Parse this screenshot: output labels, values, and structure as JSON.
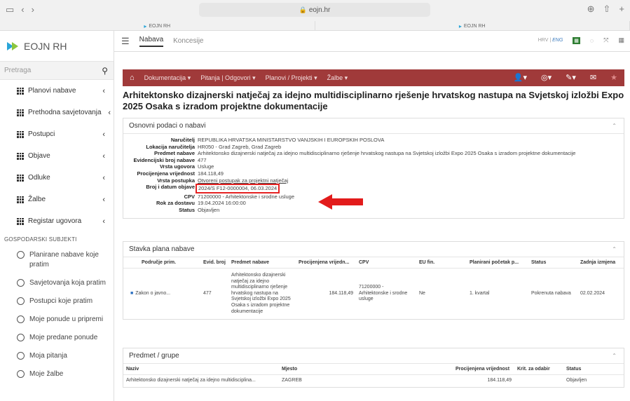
{
  "browser": {
    "url": "eojn.hr",
    "tabs": [
      "EOJN RH",
      "EOJN RH"
    ]
  },
  "sidebar": {
    "brand": "EOJN RH",
    "search_placeholder": "Pretraga",
    "nav": [
      {
        "label": "Planovi nabave"
      },
      {
        "label": "Prethodna savjetovanja"
      },
      {
        "label": "Postupci"
      },
      {
        "label": "Objave"
      },
      {
        "label": "Odluke"
      },
      {
        "label": "Žalbe"
      },
      {
        "label": "Registar ugovora"
      }
    ],
    "section_title": "GOSPODARSKI SUBJEKTI",
    "radio_items": [
      {
        "label": "Planirane nabave koje pratim"
      },
      {
        "label": "Savjetovanja koja pratim"
      },
      {
        "label": "Postupci koje pratim"
      },
      {
        "label": "Moje ponude u pripremi"
      },
      {
        "label": "Moje predane ponude"
      },
      {
        "label": "Moja pitanja"
      },
      {
        "label": "Moje žalbe"
      }
    ]
  },
  "topbar": {
    "tab_active": "Nabava",
    "tab_inactive": "Koncesije",
    "lang_hrv": "HRV",
    "lang_sep": "|",
    "lang_eng": "ENG"
  },
  "redbar": {
    "menus": [
      "Dokumentacija ▾",
      "Pitanja | Odgovori ▾",
      "Planovi / Projekti ▾",
      "Žalbe ▾"
    ]
  },
  "page": {
    "title": "Arhitektonsko dizajnerski natječaj za idejno multidisciplinarno rješenje hrvatskog nastupa na Svjetskoj izložbi Expo 2025 Osaka s izradom projektne dokumentacije"
  },
  "basic": {
    "header": "Osnovni podaci o nabavi",
    "rows": [
      {
        "k": "Naručitelj",
        "v": "REPUBLIKA HRVATSKA MINISTARSTVO VANJSKIH I EUROPSKIH POSLOVA"
      },
      {
        "k": "Lokacija naručitelja",
        "v": "HR050 - Grad Zagreb, Grad Zagreb"
      },
      {
        "k": "Predmet nabave",
        "v": "Arhitektonsko dizajnerski natječaj za idejno multidisciplinarno rješenje hrvatskog nastupa na Svjetskoj izložbi Expo 2025 Osaka s izradom projektne dokumentacije"
      },
      {
        "k": "Evidencijski broj nabave",
        "v": "477"
      },
      {
        "k": "Vrsta ugovora",
        "v": "Usluge"
      },
      {
        "k": "Procijenjena vrijednost",
        "v": "184.118,49"
      },
      {
        "k": "Vrsta postupka",
        "v": "Otvoreni postupak za projektni natječaj"
      },
      {
        "k": "Broj i datum objave",
        "v": "2024/S F12-0000004, 06.03.2024"
      },
      {
        "k": "CPV",
        "v": "71200000 - Arhitektonske i srodne usluge"
      },
      {
        "k": "Rok za dostavu",
        "v": "19.04.2024 16:00:00"
      },
      {
        "k": "Status",
        "v": "Objavljen"
      }
    ]
  },
  "plan": {
    "header": "Stavka plana nabave",
    "columns": [
      "Područje prim.",
      "Evid. broj",
      "Predmet nabave",
      "Procijenjena vrijedn...",
      "CPV",
      "EU fin.",
      "Planirani početak p...",
      "Status",
      "Zadnja izmjena"
    ],
    "row": {
      "podrucje": "Zakon o javno...",
      "evid": "477",
      "predmet": "Arhitektonsko dizajnerski natječaj za idejno multidisciplinarno rješenje hrvatskog nastupa na Svjetskoj izložbi Expo 2025 Osaka s izradom projektne dokumentacije",
      "vrijednost": "184.118,49",
      "cpv": "71200000 - Arhitektonske i srodne usluge",
      "eu": "Ne",
      "pocetak": "1. kvartal",
      "status": "Pokrenuta nabava",
      "izmjena": "02.02.2024"
    }
  },
  "groups": {
    "header": "Predmet / grupe",
    "columns": [
      "Naziv",
      "Mjesto",
      "Procijenjena vrijednost",
      "Krit. za odabir",
      "Status"
    ],
    "row": {
      "naziv": "Arhitektonsko dizajnerski natječaj za idejno multidisciplina...",
      "mjesto": "ZAGREB",
      "vrijednost": "184.118,49",
      "krit": "",
      "status": "Objavljen"
    }
  },
  "colors": {
    "accent_red": "#a03a3a",
    "highlight": "#e21b1b",
    "brand_blue": "#2aa5d8",
    "brand_green": "#8cc63f"
  }
}
